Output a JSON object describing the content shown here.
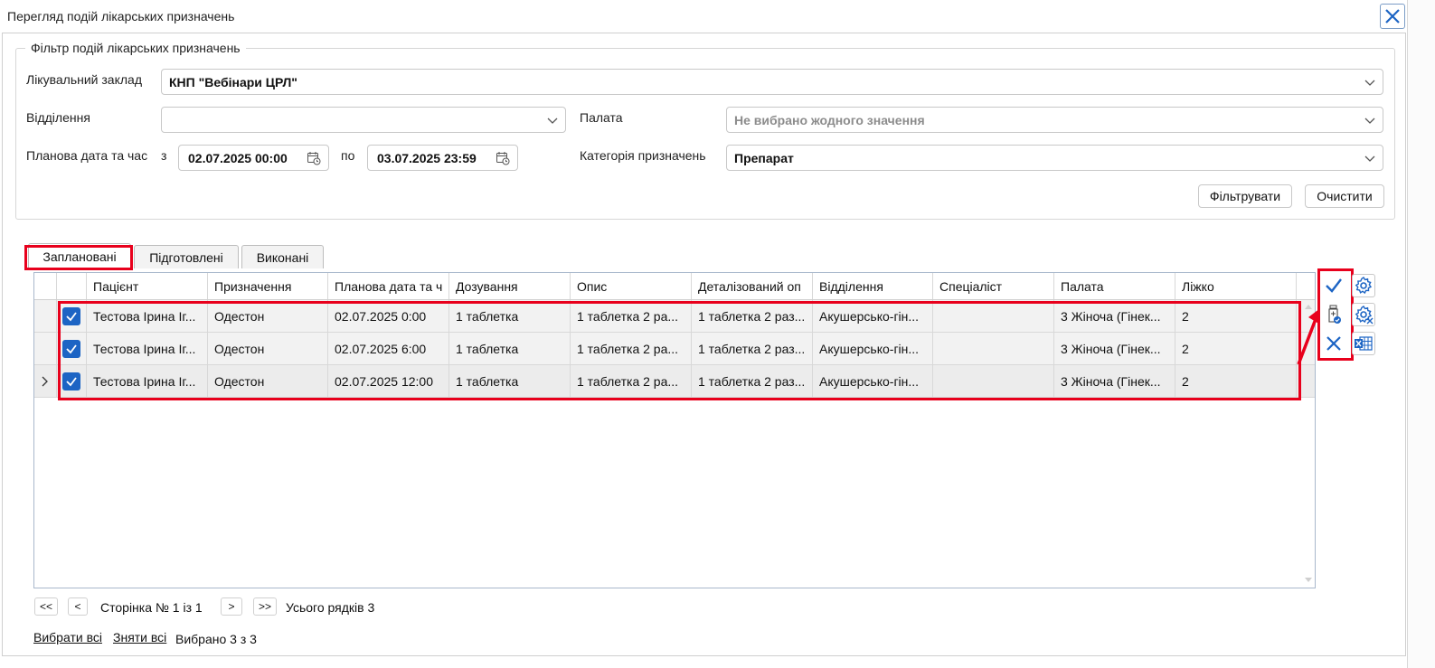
{
  "window": {
    "title": "Перегляд подій лікарських призначень"
  },
  "filter": {
    "legend": "Фільтр подій лікарських призначень",
    "facility_label": "Лікувальний заклад",
    "facility_value": "КНП \"Вебінари ЦРЛ\"",
    "department_label": "Відділення",
    "department_value": "",
    "ward_label": "Палата",
    "ward_placeholder": "Не вибрано жодного значення",
    "planned_label": "Планова дата та час",
    "from_label": "з",
    "from_value": "02.07.2025 00:00",
    "to_label": "по",
    "to_value": "03.07.2025 23:59",
    "category_label": "Категорія призначень",
    "category_value": "Препарат",
    "filter_button": "Фільтрувати",
    "clear_button": "Очистити"
  },
  "tabs": [
    {
      "label": "Заплановані",
      "active": true
    },
    {
      "label": "Підготовлені",
      "active": false
    },
    {
      "label": "Виконані",
      "active": false
    }
  ],
  "grid": {
    "columns": [
      "Пацієнт",
      "Призначення",
      "Планова дата та ч",
      "Дозування",
      "Опис",
      "Деталізований оп",
      "Відділення",
      "Спеціаліст",
      "Палата",
      "Ліжко"
    ],
    "rows": [
      {
        "patient": "Тестова Ірина Іг...",
        "assignment": "Одестон",
        "date": "02.07.2025 0:00",
        "dose": "1 таблетка",
        "desc": "1 таблетка 2 ра...",
        "detail": "1 таблетка 2 раз...",
        "dept": "Акушерсько-гін...",
        "specialist": "",
        "ward": "3 Жіноча (Гінек...",
        "bed": "2",
        "checked": true,
        "current": false
      },
      {
        "patient": "Тестова Ірина Іг...",
        "assignment": "Одестон",
        "date": "02.07.2025 6:00",
        "dose": "1 таблетка",
        "desc": "1 таблетка 2 ра...",
        "detail": "1 таблетка 2 раз...",
        "dept": "Акушерсько-гін...",
        "specialist": "",
        "ward": "3 Жіноча (Гінек...",
        "bed": "2",
        "checked": true,
        "current": false
      },
      {
        "patient": "Тестова Ірина Іг...",
        "assignment": "Одестон",
        "date": "02.07.2025 12:00",
        "dose": "1 таблетка",
        "desc": "1 таблетка 2 ра...",
        "detail": "1 таблетка 2 раз...",
        "dept": "Акушерсько-гін...",
        "specialist": "",
        "ward": "3 Жіноча (Гінек...",
        "bed": "2",
        "checked": true,
        "current": true
      }
    ]
  },
  "pager": {
    "first": "<<",
    "prev": "<",
    "page_text": "Сторінка № 1 із 1",
    "next": ">",
    "last": ">>",
    "total_text": "Усього рядків 3"
  },
  "selection": {
    "select_all": "Вибрати всі",
    "deselect_all": "Зняти всі",
    "selected_text": "Вибрано 3 з 3"
  },
  "colors": {
    "accent": "#1c64c4",
    "highlight": "#e8001c"
  }
}
